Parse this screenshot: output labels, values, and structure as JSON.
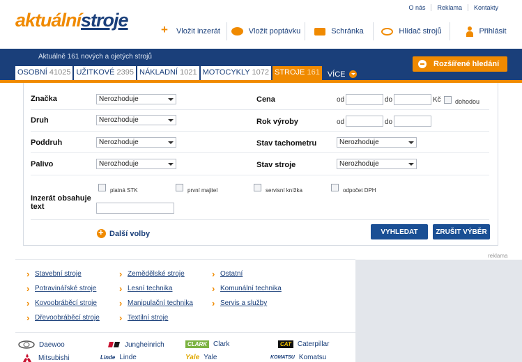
{
  "header": {
    "logo_part1": "aktuální",
    "logo_part2": "stroje",
    "top_links": [
      "O nás",
      "Reklama",
      "Kontakty"
    ],
    "nav": [
      {
        "label": "Vložit inzerát",
        "icon": "plus-icon"
      },
      {
        "label": "Vložit poptávku",
        "icon": "speech-bubble-icon"
      },
      {
        "label": "Schránka",
        "icon": "folder-icon"
      },
      {
        "label": "Hlídač strojů",
        "icon": "eye-icon"
      },
      {
        "label": "Přihlásit",
        "icon": "user-icon"
      }
    ]
  },
  "band": {
    "summary": "Aktuálně 161 nových a ojetých strojů",
    "categories": [
      {
        "label": "OSOBNÍ",
        "count": "41025"
      },
      {
        "label": "UŽITKOVÉ",
        "count": "2395"
      },
      {
        "label": "NÁKLADNÍ",
        "count": "1021"
      },
      {
        "label": "MOTOCYKLY",
        "count": "1072"
      },
      {
        "label": "STROJE",
        "count": "161"
      }
    ],
    "more_label": "VÍCE",
    "advanced_search": "Rozšířené hledání",
    "accent": "#f08a00",
    "brand_blue": "#1a3f7a"
  },
  "search": {
    "fields": {
      "znacka": {
        "label": "Značka",
        "value": "Nerozhoduje"
      },
      "druh": {
        "label": "Druh",
        "value": "Nerozhoduje"
      },
      "poddruh": {
        "label": "Poddruh",
        "value": "Nerozhoduje"
      },
      "palivo": {
        "label": "Palivo",
        "value": "Nerozhoduje"
      },
      "cena": {
        "label": "Cena",
        "from": "od",
        "to": "do",
        "currency": "Kč",
        "negotiable": "dohodou"
      },
      "rok": {
        "label": "Rok výroby",
        "from": "od",
        "to": "do"
      },
      "tachometr": {
        "label": "Stav tachometru",
        "value": "Nerozhoduje"
      },
      "stav": {
        "label": "Stav stroje",
        "value": "Nerozhoduje"
      }
    },
    "checkboxes": [
      "platná STK",
      "první majitel",
      "servisní knížka",
      "odpočet DPH"
    ],
    "text_label": "Inzerát obsahuje text",
    "more_options": "Další volby",
    "search_button": "VYHLEDAT",
    "reset_button": "ZRUŠIT VÝBĚR"
  },
  "category_links": [
    [
      "Stavební stroje",
      "Zemědělské stroje",
      "Ostatní"
    ],
    [
      "Potravinářské stroje",
      "Lesní technika",
      "Komunální technika"
    ],
    [
      "Kovoobráběcí stroje",
      "Manipulační technika",
      "Servis a služby"
    ],
    [
      "Dřevoobráběcí stroje",
      "Textilní stroje"
    ]
  ],
  "ad_label": "reklama",
  "brands": [
    {
      "name": "Daewoo",
      "logo": "daewoo-logo"
    },
    {
      "name": "Jungheinrich",
      "logo": "jungheinrich-logo"
    },
    {
      "name": "Clark",
      "logo": "clark-logo",
      "logo_text": "CLARK"
    },
    {
      "name": "Caterpillar",
      "logo": "caterpillar-logo",
      "logo_text": "CAT"
    },
    {
      "name": "Mitsubishi",
      "logo": "mitsubishi-logo"
    },
    {
      "name": "Linde",
      "logo": "linde-logo",
      "logo_text": "Linde"
    },
    {
      "name": "Yale",
      "logo": "yale-logo",
      "logo_text": "Yale"
    },
    {
      "name": "Komatsu",
      "logo": "komatsu-logo",
      "logo_text": "KOMATSU"
    }
  ]
}
